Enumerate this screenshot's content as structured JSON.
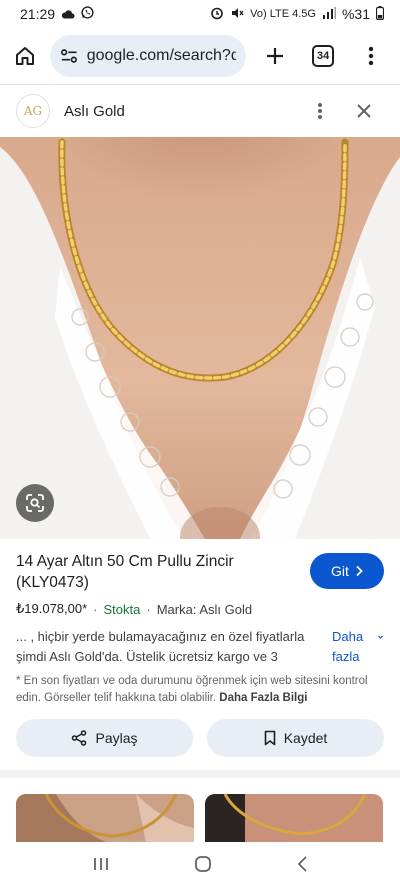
{
  "status": {
    "time": "21:29",
    "network": "Vo) LTE 4.5G",
    "battery": "%31"
  },
  "browser": {
    "url": "google.com/search?q=",
    "tab_count": "34"
  },
  "source": {
    "logo_text": "AG",
    "name": "Aslı Gold"
  },
  "product": {
    "title": "14 Ayar Altın 50 Cm Pullu Zincir (KLY0473)",
    "go_label": "Git",
    "price": "₺19.078,00*",
    "stock": "Stokta",
    "brand": "Marka: Aslı Gold",
    "description": "... , hiçbir yerde bulamayacağınız en özel fiyatlarla şimdi Aslı Gold'da. Üstelik ücretsiz kargo ve 3",
    "more_label": "Daha fazla",
    "disclaimer": "* En son fiyatları ve oda durumunu öğrenmek için web sitesini kontrol edin. Görseller telif hakkına tabi olabilir.",
    "disclaimer_link": "Daha Fazla Bilgi"
  },
  "actions": {
    "share": "Paylaş",
    "save": "Kaydet"
  },
  "colors": {
    "accent": "#0b57d0",
    "stock": "#137333",
    "chip_bg": "#e9eef6"
  }
}
